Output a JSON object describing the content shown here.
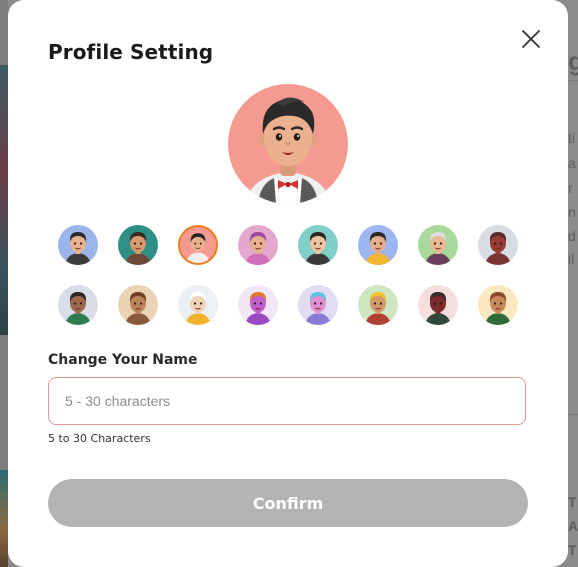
{
  "modal": {
    "title": "Profile Setting",
    "close_icon": "close-icon",
    "avatars": {
      "selected_index": 2,
      "items": [
        {
          "name": "avatar-man-suit",
          "bg": "#9bb4ea",
          "skin": "#e6b48f",
          "hair": "#2d2d2d",
          "shirt": "#3b3b3b"
        },
        {
          "name": "avatar-man-teal",
          "bg": "#2f8f86",
          "skin": "#d79a70",
          "hair": "#3a2a22",
          "shirt": "#6d4a37"
        },
        {
          "name": "avatar-man-bowtie",
          "bg": "#f59a90",
          "skin": "#e9b08c",
          "hair": "#262626",
          "shirt": "#f0f0f0"
        },
        {
          "name": "avatar-woman-purple",
          "bg": "#e4a8cf",
          "skin": "#e7b18e",
          "hair": "#a04aa0",
          "shirt": "#d070b8"
        },
        {
          "name": "avatar-woman-teal",
          "bg": "#7fcfc8",
          "skin": "#eec3a1",
          "hair": "#2f2522",
          "shirt": "#3a3a3a"
        },
        {
          "name": "avatar-man-yellow",
          "bg": "#9db5f0",
          "skin": "#e2b08c",
          "hair": "#2c2a2a",
          "shirt": "#f2b52e"
        },
        {
          "name": "avatar-old-man",
          "bg": "#a8d99a",
          "skin": "#e6b894",
          "hair": "#dcdcdc",
          "shirt": "#6b3e5b"
        },
        {
          "name": "avatar-hooded",
          "bg": "#d8dde4",
          "skin": "#9a3a34",
          "hair": "#5b2b28",
          "shirt": "#7a3431"
        },
        {
          "name": "avatar-woman-green",
          "bg": "#d9dde8",
          "skin": "#9b6a4c",
          "hair": "#2d2520",
          "shirt": "#2f7d4e"
        },
        {
          "name": "avatar-woman-waving",
          "bg": "#ead3b4",
          "skin": "#b9845c",
          "hair": "#6c3e25",
          "shirt": "#8b5a3c"
        },
        {
          "name": "avatar-astronaut",
          "bg": "#eceff3",
          "skin": "#f0d2b4",
          "hair": "#ffffff",
          "shirt": "#f0b32e"
        },
        {
          "name": "avatar-robot-purple",
          "bg": "#f0e6f6",
          "skin": "#c060d0",
          "hair": "#e07a2a",
          "shirt": "#9a4ac0"
        },
        {
          "name": "avatar-cyber",
          "bg": "#e2dcf0",
          "skin": "#e08fd0",
          "hair": "#5fc2e0",
          "shirt": "#8a7ad8"
        },
        {
          "name": "avatar-king",
          "bg": "#cfe6c2",
          "skin": "#d39a6a",
          "hair": "#f0c030",
          "shirt": "#b04030"
        },
        {
          "name": "avatar-masked",
          "bg": "#f4dede",
          "skin": "#7a2a2a",
          "hair": "#3a2a2a",
          "shirt": "#2f4a3a"
        },
        {
          "name": "avatar-man-smile",
          "bg": "#f9e8c0",
          "skin": "#c88a5a",
          "hair": "#8a4a2a",
          "shirt": "#2f6a3a"
        }
      ]
    },
    "name_label": "Change Your Name",
    "name_input": {
      "value": "",
      "placeholder": "5 - 30 characters"
    },
    "hint": "5 to 30 Characters",
    "confirm_label": "Confirm",
    "colors": {
      "confirm_disabled": "#b3b3b3",
      "selected_border": "#f07d1e",
      "input_border": "#e59a96"
    }
  },
  "background": {
    "right_text": [
      "g",
      "ti",
      "a",
      "r",
      "n",
      "d",
      "il",
      "T",
      "A",
      "T"
    ]
  }
}
